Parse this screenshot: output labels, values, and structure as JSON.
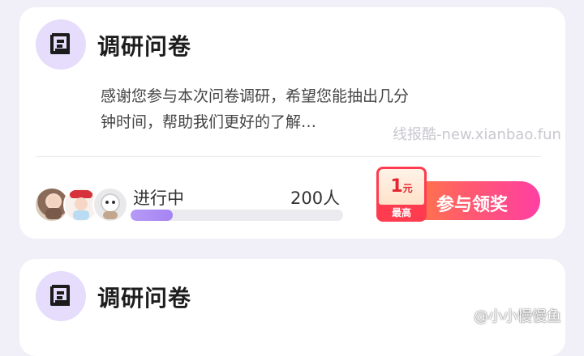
{
  "cards": [
    {
      "title": "调研问卷",
      "description": "感谢您参与本次问卷调研，希望您能抽出几分钟时间，帮助我们更好的了解…",
      "status": "进行中",
      "participants": "200人",
      "progress": 0.2,
      "reward": {
        "amount": "1",
        "unit": "元",
        "note": "最高"
      },
      "button_label": "参与领奖"
    },
    {
      "title": "调研问卷"
    }
  ],
  "watermarks": {
    "top": "线报酷-new.xianbao.fun",
    "bottom": "@小小慢慢鱼"
  },
  "icons": [
    "scroll-icon",
    "avatar-1",
    "avatar-2",
    "avatar-3"
  ],
  "colors": {
    "accent": "#a683f3",
    "button_start": "#ff8c2b",
    "button_end": "#ff3fa3"
  }
}
